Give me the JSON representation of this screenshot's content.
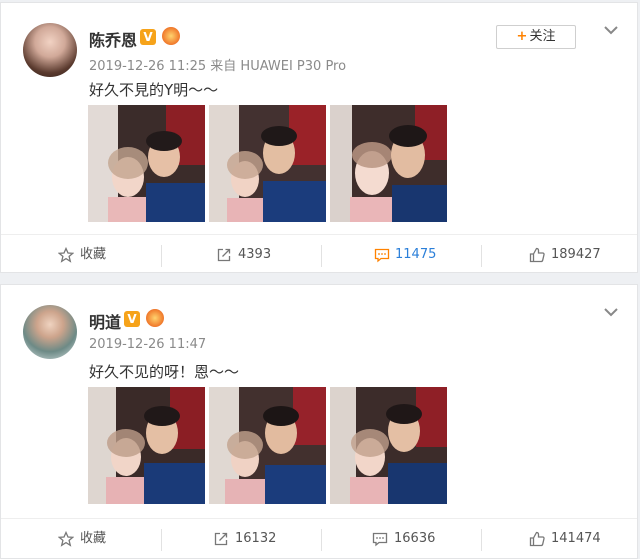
{
  "posts": [
    {
      "author": "陈乔恩",
      "verified_badge": "V",
      "timestamp": "2019-12-26 11:25",
      "source": "来自 HUAWEI P30 Pro",
      "content": "好久不見的Y明～～",
      "follow_button": {
        "plus": "+",
        "label": "关注"
      },
      "actions": {
        "favorite": "收藏",
        "repost": "4393",
        "comment": "11475",
        "like": "189427"
      },
      "icons": [
        "star-icon",
        "share-icon",
        "comment-icon",
        "like-icon",
        "chevron-down-icon"
      ]
    },
    {
      "author": "明道",
      "verified_badge": "V",
      "timestamp": "2019-12-26 11:47",
      "content": "好久不见的呀！恩～～",
      "actions": {
        "favorite": "收藏",
        "repost": "16132",
        "comment": "16636",
        "like": "141474"
      },
      "icons": [
        "star-icon",
        "share-icon",
        "comment-icon",
        "like-icon",
        "chevron-down-icon"
      ]
    }
  ],
  "colors": {
    "accent_orange": "#ff8200",
    "badge_yellow": "#f6a31a",
    "highlight_blue": "#2b7fd9"
  }
}
